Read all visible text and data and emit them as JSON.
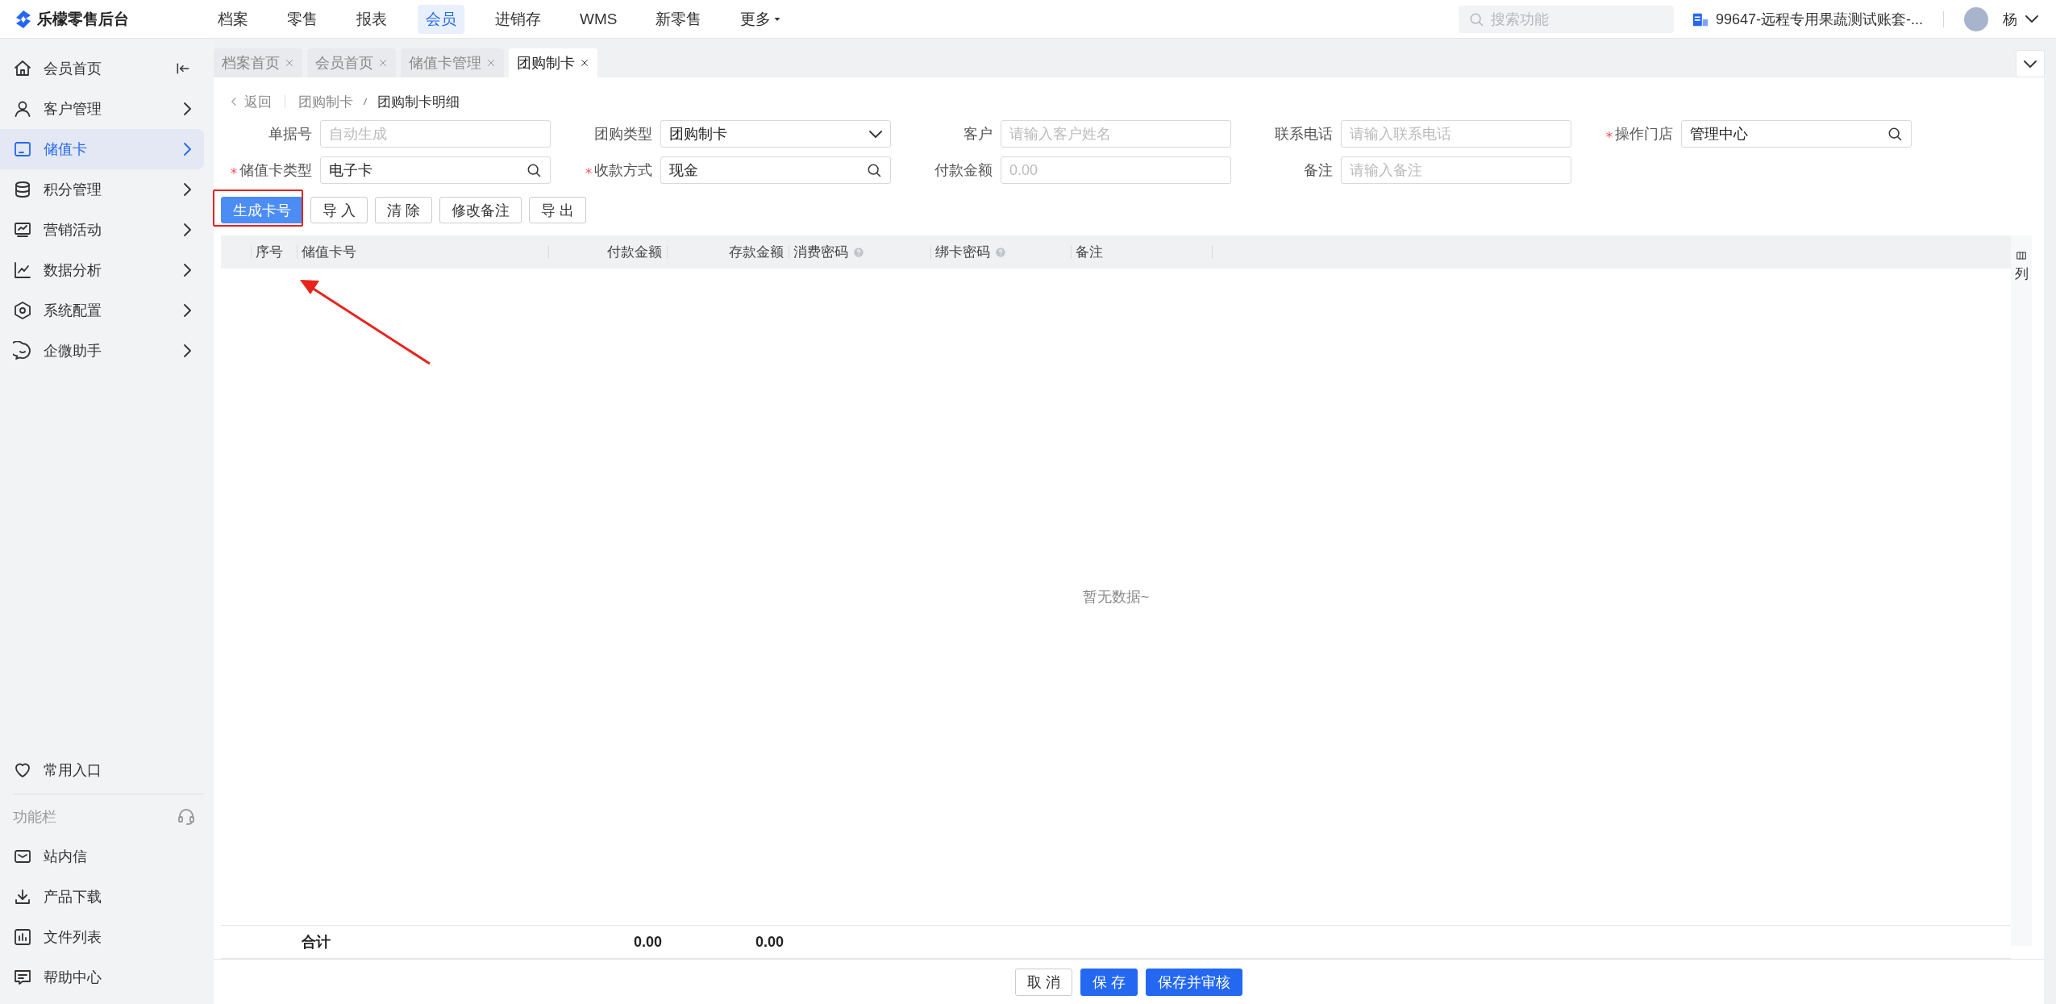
{
  "app": {
    "title": "乐檬零售后台"
  },
  "top_nav": [
    {
      "label": "档案",
      "selected": false,
      "kind": "link"
    },
    {
      "label": "零售",
      "selected": false,
      "kind": "link"
    },
    {
      "label": "报表",
      "selected": false,
      "kind": "link"
    },
    {
      "label": "会员",
      "selected": true,
      "kind": "link"
    },
    {
      "label": "进销存",
      "selected": false,
      "kind": "link"
    },
    {
      "label": "WMS",
      "selected": false,
      "kind": "link"
    },
    {
      "label": "新零售",
      "selected": false,
      "kind": "link"
    },
    {
      "label": "更多",
      "selected": false,
      "kind": "dropdown"
    }
  ],
  "search": {
    "placeholder": "搜索功能"
  },
  "account": {
    "label": "99647-远程专用果蔬测试账套-..."
  },
  "user": {
    "name": "杨"
  },
  "sidebar": {
    "items": [
      {
        "label": "会员首页",
        "selected": false,
        "kind": "home"
      },
      {
        "label": "客户管理",
        "selected": false,
        "kind": "group"
      },
      {
        "label": "储值卡",
        "selected": true,
        "kind": "group"
      },
      {
        "label": "积分管理",
        "selected": false,
        "kind": "group"
      },
      {
        "label": "营销活动",
        "selected": false,
        "kind": "group"
      },
      {
        "label": "数据分析",
        "selected": false,
        "kind": "group"
      },
      {
        "label": "系统配置",
        "selected": false,
        "kind": "group"
      },
      {
        "label": "企微助手",
        "selected": false,
        "kind": "group"
      }
    ],
    "favorites": "常用入口",
    "section_title": "功能栏",
    "tools": [
      "站内信",
      "产品下载",
      "文件列表",
      "帮助中心"
    ]
  },
  "page_tabs": [
    {
      "label": "档案首页",
      "selected": false
    },
    {
      "label": "会员首页",
      "selected": false
    },
    {
      "label": "储值卡管理",
      "selected": false
    },
    {
      "label": "团购制卡",
      "selected": true
    }
  ],
  "breadcrumb": {
    "back": "返回",
    "items": [
      "团购制卡",
      "团购制卡明细"
    ]
  },
  "form": {
    "fields": [
      {
        "label": "单据号",
        "required": false,
        "kind": "text",
        "placeholder": "自动生成"
      },
      {
        "label": "团购类型",
        "required": false,
        "kind": "select",
        "value": "团购制卡"
      },
      {
        "label": "客户",
        "required": false,
        "kind": "text",
        "placeholder": "请输入客户姓名"
      },
      {
        "label": "联系电话",
        "required": false,
        "kind": "text",
        "placeholder": "请输入联系电话"
      },
      {
        "label": "操作门店",
        "required": true,
        "kind": "search",
        "value": "管理中心"
      },
      {
        "label": "储值卡类型",
        "required": true,
        "kind": "search",
        "value": "电子卡"
      },
      {
        "label": "收款方式",
        "required": true,
        "kind": "search",
        "value": "现金"
      },
      {
        "label": "付款金额",
        "required": false,
        "kind": "text",
        "placeholder": "0.00"
      },
      {
        "label": "备注",
        "required": false,
        "kind": "text",
        "placeholder": "请输入备注"
      }
    ]
  },
  "toolbar": [
    {
      "label": "生成卡号",
      "kind": "primary"
    },
    {
      "label": "导 入",
      "kind": "default"
    },
    {
      "label": "清 除",
      "kind": "default"
    },
    {
      "label": "修改备注",
      "kind": "default"
    },
    {
      "label": "导 出",
      "kind": "default"
    }
  ],
  "table": {
    "columns": [
      {
        "label": "序号",
        "kind": "text",
        "help": false
      },
      {
        "label": "储值卡号",
        "kind": "text",
        "help": false
      },
      {
        "label": "付款金额",
        "kind": "amount",
        "help": false
      },
      {
        "label": "存款金额",
        "kind": "amount",
        "help": false
      },
      {
        "label": "消费密码",
        "kind": "text",
        "help": true
      },
      {
        "label": "绑卡密码",
        "kind": "text",
        "help": true
      },
      {
        "label": "备注",
        "kind": "text",
        "help": false
      }
    ],
    "empty_text": "暂无数据~",
    "footer": {
      "label": "合计",
      "totals": [
        "0.00",
        "0.00"
      ]
    },
    "column_settings": "列"
  },
  "actions": [
    {
      "label": "取 消",
      "kind": "default"
    },
    {
      "label": "保 存",
      "kind": "primary"
    },
    {
      "label": "保存并审核",
      "kind": "primary"
    }
  ]
}
